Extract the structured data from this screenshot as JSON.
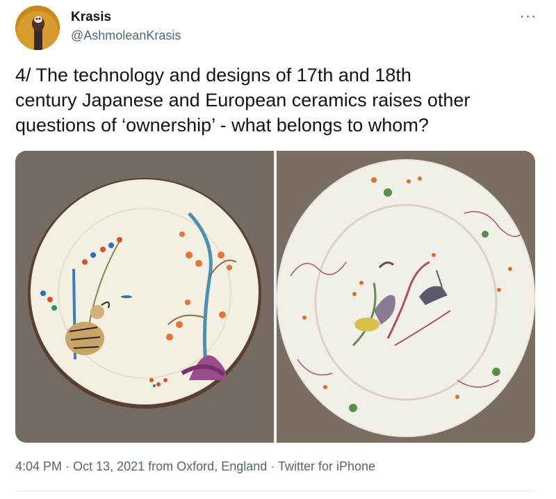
{
  "author": {
    "display_name": "Krasis",
    "handle": "@AshmoleanKrasis"
  },
  "tweet": {
    "text": "4/ The technology and designs of 17th and 18th\ncentury Japanese and European ceramics raises other\nquestions of ‘ownership’ - what belongs to whom?",
    "time": "4:04 PM",
    "date": "Oct 13, 2021",
    "location": "from Oxford, England",
    "source": "Twitter for iPhone",
    "separator": "·"
  },
  "menu": {
    "more_label": "···"
  },
  "media": {
    "photos": [
      "plate-photo-left",
      "plate-photo-right"
    ]
  },
  "colors": {
    "text_primary": "#0f1419",
    "text_secondary": "#536471",
    "avatar_bg": "#c9871f"
  }
}
